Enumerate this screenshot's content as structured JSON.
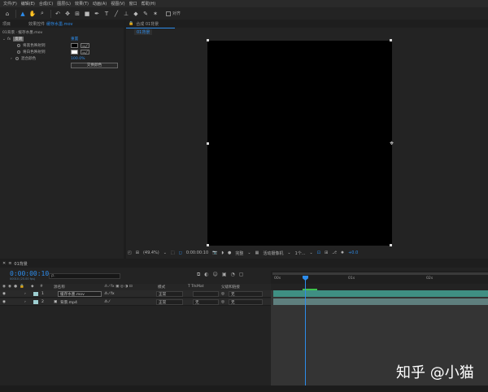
{
  "menu": [
    "文件(F)",
    "编辑(E)",
    "合成(C)",
    "图层(L)",
    "效果(T)",
    "动画(A)",
    "视图(V)",
    "窗口",
    "帮助(H)"
  ],
  "toolbar": {
    "tools": [
      "home-icon",
      "selection-arrow-icon",
      "hand-icon",
      "zoom-icon",
      "rotate-icon",
      "camera-orbit-icon",
      "pan-behind-icon",
      "rectangle-icon",
      "pen-icon",
      "type-icon",
      "brush-icon",
      "clone-stamp-icon",
      "eraser-icon",
      "roto-brush-icon",
      "puppet-pin-icon"
    ],
    "snap_label": "对齐"
  },
  "effect_controls": {
    "left_tab": "项目",
    "tab_label": "效果控件",
    "tab_layer": "缓存水墨.mov",
    "breadcrumb": "01背景 · 缓存水墨.mov",
    "effect_name": "反转",
    "effect_reset": "重置",
    "rows": [
      {
        "label": "将黑色映射到",
        "type": "color",
        "color": "#000000"
      },
      {
        "label": "将白色映射到",
        "type": "color",
        "color": "#ffffff"
      },
      {
        "label": "混合颜色",
        "type": "value",
        "value": "100.0%"
      }
    ],
    "swap_button": "交换颜色"
  },
  "composition": {
    "tab_label": "合成 01背景",
    "comp_name_chip": "01背景",
    "viewer_bar": {
      "zoom": "(49.4%)",
      "timecode": "0:00:00:10",
      "quality": "完整",
      "camera": "活动摄像机",
      "views": "1个...",
      "exposure": "+0.0"
    }
  },
  "timeline": {
    "tab_label": "01背景",
    "timecode": "0:00:00:10",
    "subcode": "00010 (25.00 fps)",
    "search_placeholder": "ρ.",
    "columns": {
      "source_name": "源名称",
      "mode": "模式",
      "track_matte": "T TrkMat",
      "parent": "父级和链接"
    },
    "layers": [
      {
        "num": "1",
        "name": "缓存水墨.mov",
        "mode": "正常",
        "trkmat": "",
        "parent": "无"
      },
      {
        "num": "2",
        "name": "背景.mp4",
        "mode": "正常",
        "trkmat": "无",
        "parent": "无"
      }
    ],
    "ruler_ticks": [
      "00s",
      "01s",
      "02s"
    ]
  },
  "watermark": "知乎 @小猫",
  "colors": {
    "accent": "#2d8ceb",
    "layer1": "#3f8f83",
    "layer2": "#5f7f7e",
    "label": "#9ecfd2"
  }
}
